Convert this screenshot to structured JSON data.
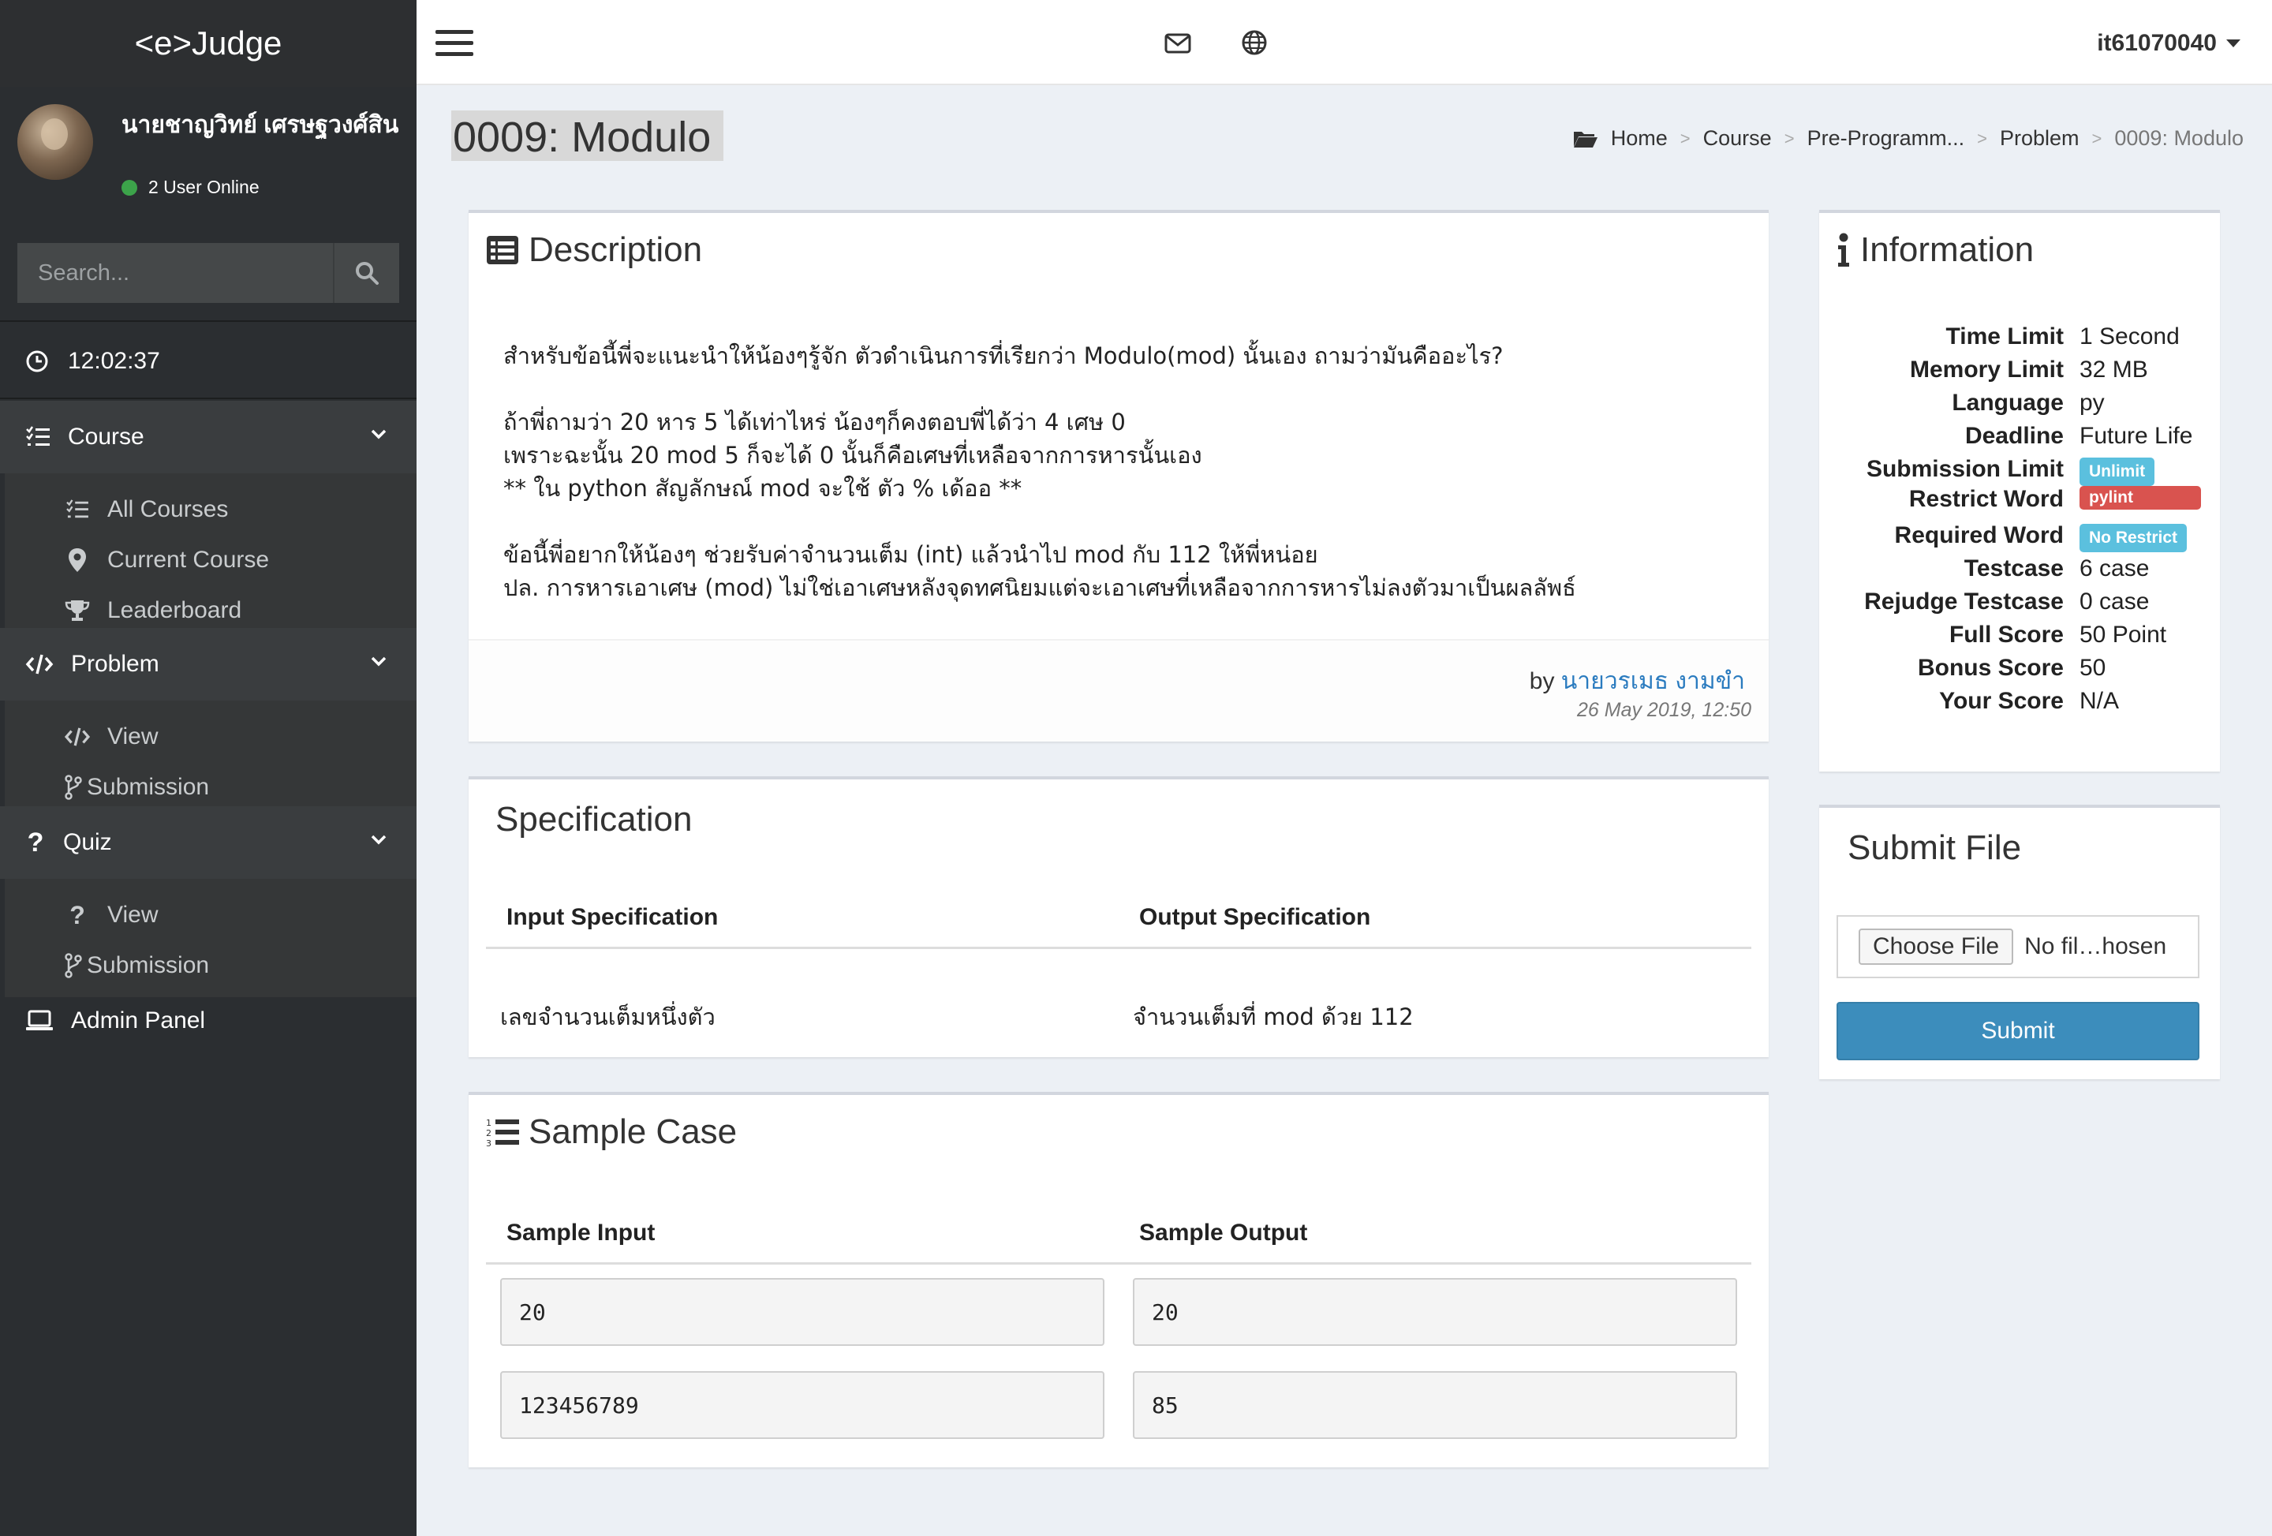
{
  "app": {
    "logo": "<e>Judge"
  },
  "user_panel": {
    "name": "นายชาญวิทย์ เศรษฐวงศ์สิน",
    "status": "2 User Online"
  },
  "search": {
    "placeholder": "Search..."
  },
  "clock": "12:02:37",
  "nav": {
    "course": {
      "label": "Course",
      "items": [
        "All Courses",
        "Current Course",
        "Leaderboard"
      ]
    },
    "problem": {
      "label": "Problem",
      "items": [
        "View",
        "Submission"
      ]
    },
    "quiz": {
      "label": "Quiz",
      "items": [
        "View",
        "Submission"
      ]
    },
    "admin": "Admin Panel"
  },
  "topbar": {
    "username": "it61070040"
  },
  "page": {
    "title": "0009: Modulo",
    "breadcrumb": [
      "Home",
      "Course",
      "Pre-Programm...",
      "Problem",
      "0009: Modulo"
    ]
  },
  "description": {
    "title": "Description",
    "text": "สำหรับข้อนี้พี่จะแนะนำให้น้องๆรู้จัก ตัวดำเนินการที่เรียกว่า Modulo(mod) นั้นเอง ถามว่ามันคืออะไร?\n\nถ้าพี่ถามว่า 20 หาร 5 ได้เท่าไหร่ น้องๆก็คงตอบพี่ได้ว่า 4 เศษ 0\nเพราะฉะนั้น 20 mod 5 ก็จะได้ 0 นั้นก็คือเศษที่เหลือจากการหารนั้นเอง\n** ใน python สัญลักษณ์ mod จะใช้ ตัว % เด้ออ **\n\nข้อนี้พี่อยากให้น้องๆ ช่วยรับค่าจำนวนเต็ม (int) แล้วนำไป mod กับ 112 ให้พี่หน่อย\nปล. การหารเอาเศษ (mod) ไม่ใช่เอาเศษหลังจุดทศนิยมแต่จะเอาเศษที่เหลือจากการหารไม่ลงตัวมาเป็นผลลัพธ์",
    "by_label": "by",
    "author": "นายวรเมธ งามขำ",
    "date": "26 May 2019, 12:50"
  },
  "specification": {
    "title": "Specification",
    "input_header": "Input Specification",
    "output_header": "Output Specification",
    "input": "เลขจำนวนเต็มหนึ่งตัว",
    "output": "จำนวนเต็มที่ mod ด้วย 112"
  },
  "sample_case": {
    "title": "Sample Case",
    "input_header": "Sample Input",
    "output_header": "Sample Output",
    "rows": [
      {
        "input": "20",
        "output": "20"
      },
      {
        "input": "123456789",
        "output": "85"
      }
    ]
  },
  "information": {
    "title": "Information",
    "rows": [
      {
        "label": "Time Limit",
        "value": "1 Second"
      },
      {
        "label": "Memory Limit",
        "value": "32 MB"
      },
      {
        "label": "Language",
        "value": "py"
      },
      {
        "label": "Deadline",
        "value": "Future Life"
      },
      {
        "label": "Submission Limit",
        "badge": "Unlimit"
      },
      {
        "label": "Restrict Word",
        "badge": "pylint"
      },
      {
        "label": "Required Word",
        "badge": "No Restrict"
      },
      {
        "label": "Testcase",
        "value": "6 case"
      },
      {
        "label": "Rejudge Testcase",
        "value": "0 case"
      },
      {
        "label": "Full Score",
        "value": "50 Point"
      },
      {
        "label": "Bonus Score",
        "value": "50"
      },
      {
        "label": "Your Score",
        "value": "N/A"
      }
    ]
  },
  "submit_file": {
    "title": "Submit File",
    "choose_label": "Choose File",
    "file_status": "No fil…hosen",
    "submit_label": "Submit"
  },
  "colors": {
    "accent": "#3c8dbc",
    "badge_info": "#5bc0de",
    "badge_danger": "#d9534f",
    "sidebar": "#2b2e31"
  }
}
